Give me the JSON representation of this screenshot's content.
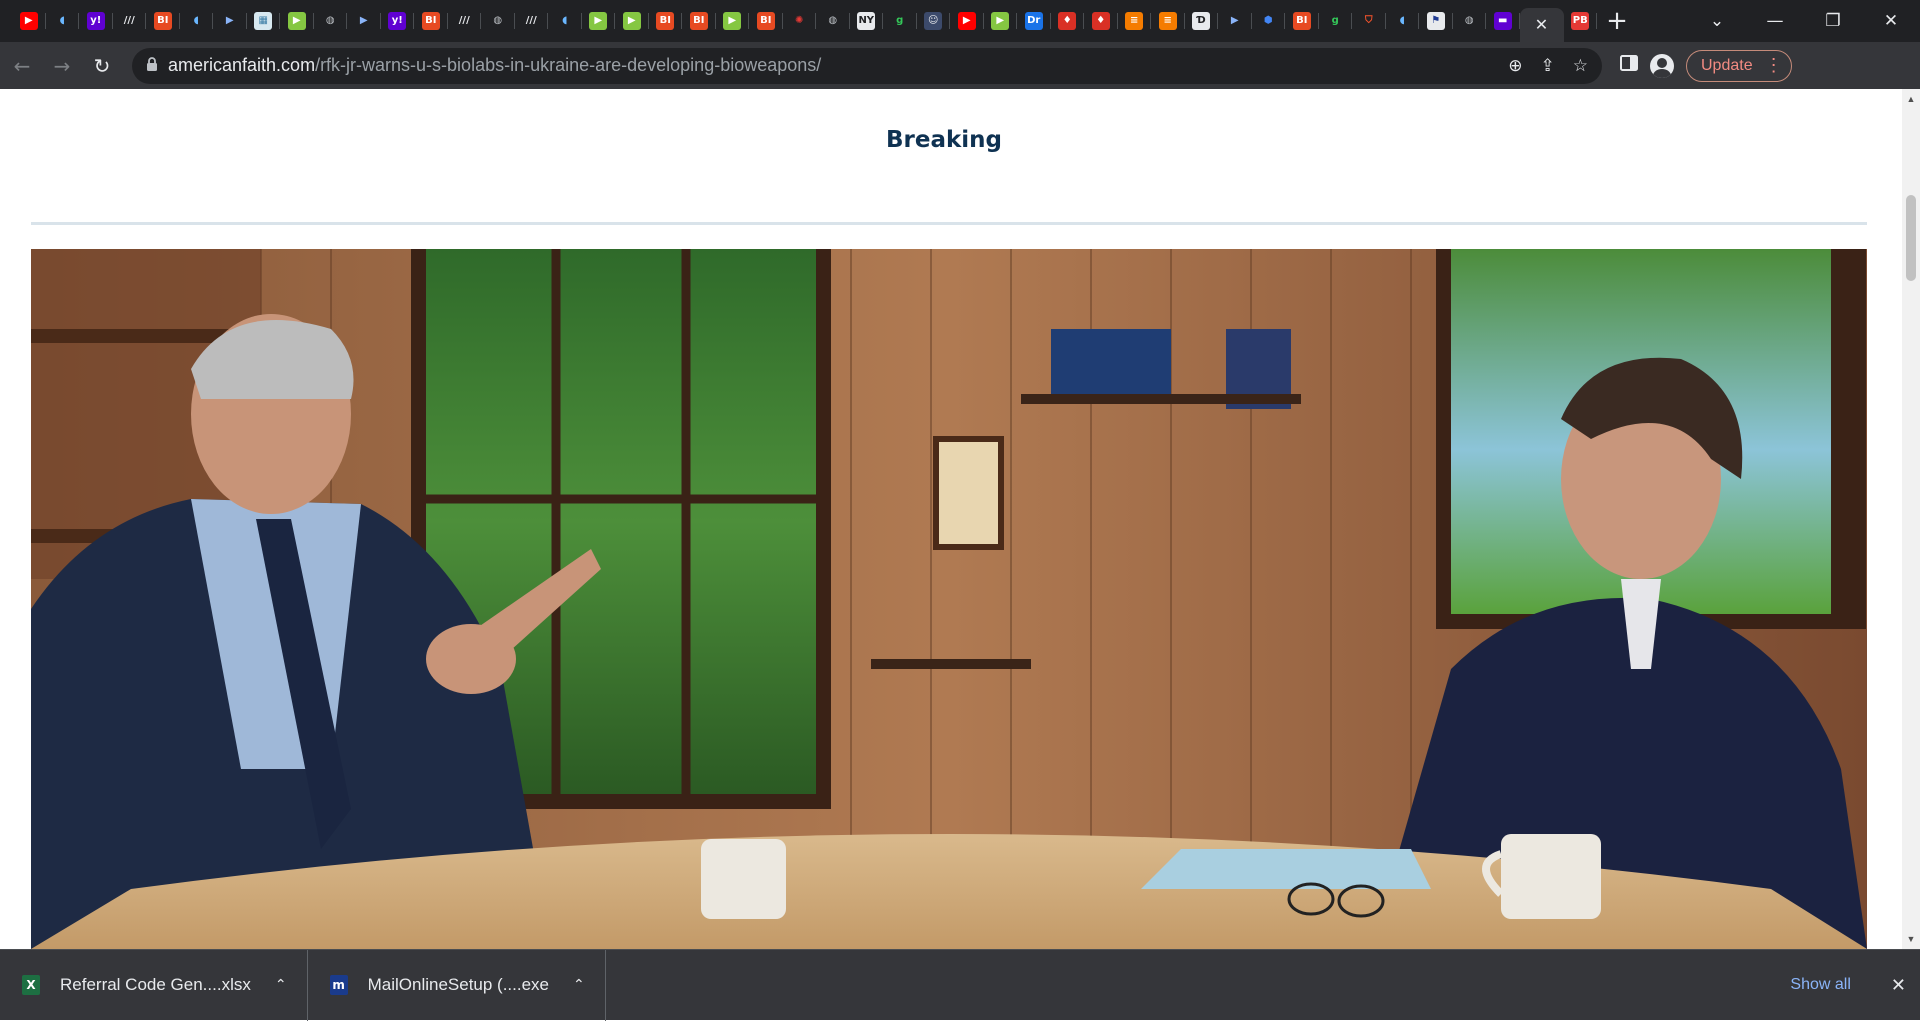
{
  "browser": {
    "tabs": [
      {
        "icon": "youtube-icon",
        "glyph": "▶",
        "bg": "#ff0000",
        "fg": "#ffffff"
      },
      {
        "icon": "shield-icon",
        "glyph": "◖",
        "bg": "#202124",
        "fg": "#6ab7ff"
      },
      {
        "icon": "yahoo-icon",
        "glyph": "y!",
        "bg": "#6001d2",
        "fg": "#ffffff"
      },
      {
        "icon": "wsj-icon",
        "glyph": "///",
        "bg": "#202124",
        "fg": "#e8eaed"
      },
      {
        "icon": "business-insider-icon",
        "glyph": "BI",
        "bg": "#e74a22",
        "fg": "#ffffff"
      },
      {
        "icon": "shield-icon",
        "glyph": "◖",
        "bg": "#202124",
        "fg": "#6ab7ff"
      },
      {
        "icon": "arrow-icon",
        "glyph": "▶",
        "bg": "#202124",
        "fg": "#8ab4f8"
      },
      {
        "icon": "map-icon",
        "glyph": "▦",
        "bg": "#d7e8f0",
        "fg": "#3a7ca5"
      },
      {
        "icon": "rumble-icon",
        "glyph": "▶",
        "bg": "#85c742",
        "fg": "#ffffff"
      },
      {
        "icon": "globe-icon",
        "glyph": "◍",
        "bg": "#202124",
        "fg": "#bdc1c6"
      },
      {
        "icon": "arrow-icon",
        "glyph": "▶",
        "bg": "#202124",
        "fg": "#8ab4f8"
      },
      {
        "icon": "yahoo-icon",
        "glyph": "y!",
        "bg": "#6001d2",
        "fg": "#ffffff"
      },
      {
        "icon": "business-insider-icon",
        "glyph": "BI",
        "bg": "#e74a22",
        "fg": "#ffffff"
      },
      {
        "icon": "wsj-icon",
        "glyph": "///",
        "bg": "#202124",
        "fg": "#e8eaed"
      },
      {
        "icon": "globe-icon",
        "glyph": "◍",
        "bg": "#202124",
        "fg": "#bdc1c6"
      },
      {
        "icon": "wsj-icon",
        "glyph": "///",
        "bg": "#202124",
        "fg": "#e8eaed"
      },
      {
        "icon": "shield-icon",
        "glyph": "◖",
        "bg": "#202124",
        "fg": "#6ab7ff"
      },
      {
        "icon": "rumble-icon",
        "glyph": "▶",
        "bg": "#85c742",
        "fg": "#ffffff"
      },
      {
        "icon": "rumble-icon",
        "glyph": "▶",
        "bg": "#85c742",
        "fg": "#ffffff"
      },
      {
        "icon": "business-insider-icon",
        "glyph": "BI",
        "bg": "#e74a22",
        "fg": "#ffffff"
      },
      {
        "icon": "business-insider-icon",
        "glyph": "BI",
        "bg": "#e74a22",
        "fg": "#ffffff"
      },
      {
        "icon": "rumble-icon",
        "glyph": "▶",
        "bg": "#85c742",
        "fg": "#ffffff"
      },
      {
        "icon": "business-insider-icon",
        "glyph": "BI",
        "bg": "#e74a22",
        "fg": "#ffffff"
      },
      {
        "icon": "burst-icon",
        "glyph": "✺",
        "bg": "#202124",
        "fg": "#e53935"
      },
      {
        "icon": "globe-icon",
        "glyph": "◍",
        "bg": "#202124",
        "fg": "#bdc1c6"
      },
      {
        "icon": "news-icon",
        "glyph": "NY",
        "bg": "#e8eaed",
        "fg": "#202124"
      },
      {
        "icon": "g-icon",
        "glyph": "g",
        "bg": "#202124",
        "fg": "#34c759"
      },
      {
        "icon": "portrait-icon",
        "glyph": "☺",
        "bg": "#3c4a6b",
        "fg": "#e8eaed"
      },
      {
        "icon": "youtube-icon",
        "glyph": "▶",
        "bg": "#ff0000",
        "fg": "#ffffff"
      },
      {
        "icon": "rumble-icon",
        "glyph": "▶",
        "bg": "#85c742",
        "fg": "#ffffff"
      },
      {
        "icon": "dr-icon",
        "glyph": "Dr",
        "bg": "#1a73e8",
        "fg": "#ffffff"
      },
      {
        "icon": "mic-icon",
        "glyph": "♦",
        "bg": "#d93025",
        "fg": "#ffffff"
      },
      {
        "icon": "mic-icon",
        "glyph": "♦",
        "bg": "#d93025",
        "fg": "#ffffff"
      },
      {
        "icon": "bookmark-icon",
        "glyph": "≡",
        "bg": "#f57c00",
        "fg": "#ffffff"
      },
      {
        "icon": "bookmark-icon",
        "glyph": "≡",
        "bg": "#f57c00",
        "fg": "#ffffff"
      },
      {
        "icon": "nyt-icon",
        "glyph": "Ɗ",
        "bg": "#e8eaed",
        "fg": "#202124"
      },
      {
        "icon": "arrow-icon",
        "glyph": "▶",
        "bg": "#202124",
        "fg": "#8ab4f8"
      },
      {
        "icon": "hex-icon",
        "glyph": "⬢",
        "bg": "#202124",
        "fg": "#4285f4"
      },
      {
        "icon": "business-insider-icon",
        "glyph": "BI",
        "bg": "#e74a22",
        "fg": "#ffffff"
      },
      {
        "icon": "g-icon",
        "glyph": "g",
        "bg": "#202124",
        "fg": "#34c759"
      },
      {
        "icon": "brave-icon",
        "glyph": "⛉",
        "bg": "#202124",
        "fg": "#fb542b"
      },
      {
        "icon": "shield-icon",
        "glyph": "◖",
        "bg": "#202124",
        "fg": "#6ab7ff"
      },
      {
        "icon": "crest-icon",
        "glyph": "⚑",
        "bg": "#e8eaed",
        "fg": "#1f3a93"
      },
      {
        "icon": "globe-icon",
        "glyph": "◍",
        "bg": "#202124",
        "fg": "#bdc1c6"
      },
      {
        "icon": "flag-icon",
        "glyph": "▬",
        "bg": "#6001d2",
        "fg": "#ffffff"
      }
    ],
    "active_tab": {
      "icon": "close-icon",
      "glyph": "✕"
    },
    "trailing_tab": {
      "icon": "pb-icon",
      "glyph": "PB",
      "bg": "#e53935",
      "fg": "#ffffff"
    },
    "new_tab_glyph": "+",
    "tab_search_glyph": "⌄",
    "window": {
      "minimize": "—",
      "restore": "❐",
      "close": "✕"
    },
    "nav": {
      "back": "←",
      "forward": "→",
      "reload": "↻"
    },
    "url": {
      "host": "americanfaith.com",
      "path": "/rfk-jr-warns-u-s-biolabs-in-ukraine-are-developing-bioweapons/"
    },
    "omnibox_icons": {
      "zoom": "⊕",
      "share": "⇪",
      "bookmark": "☆"
    },
    "update_label": "Update",
    "menu_glyph": "⋮"
  },
  "page": {
    "section_label": "Breaking"
  },
  "downloads": [
    {
      "name": "Referral Code Gen....xlsx",
      "icon": "excel-icon",
      "glyph": "X",
      "bg": "#1d6f42"
    },
    {
      "name": "MailOnlineSetup (....exe",
      "icon": "mailonline-icon",
      "glyph": "m",
      "bg": "#1a3b8c"
    }
  ],
  "downloads_show_all": "Show all",
  "downloads_close": "✕",
  "chevron_up": "⌃"
}
